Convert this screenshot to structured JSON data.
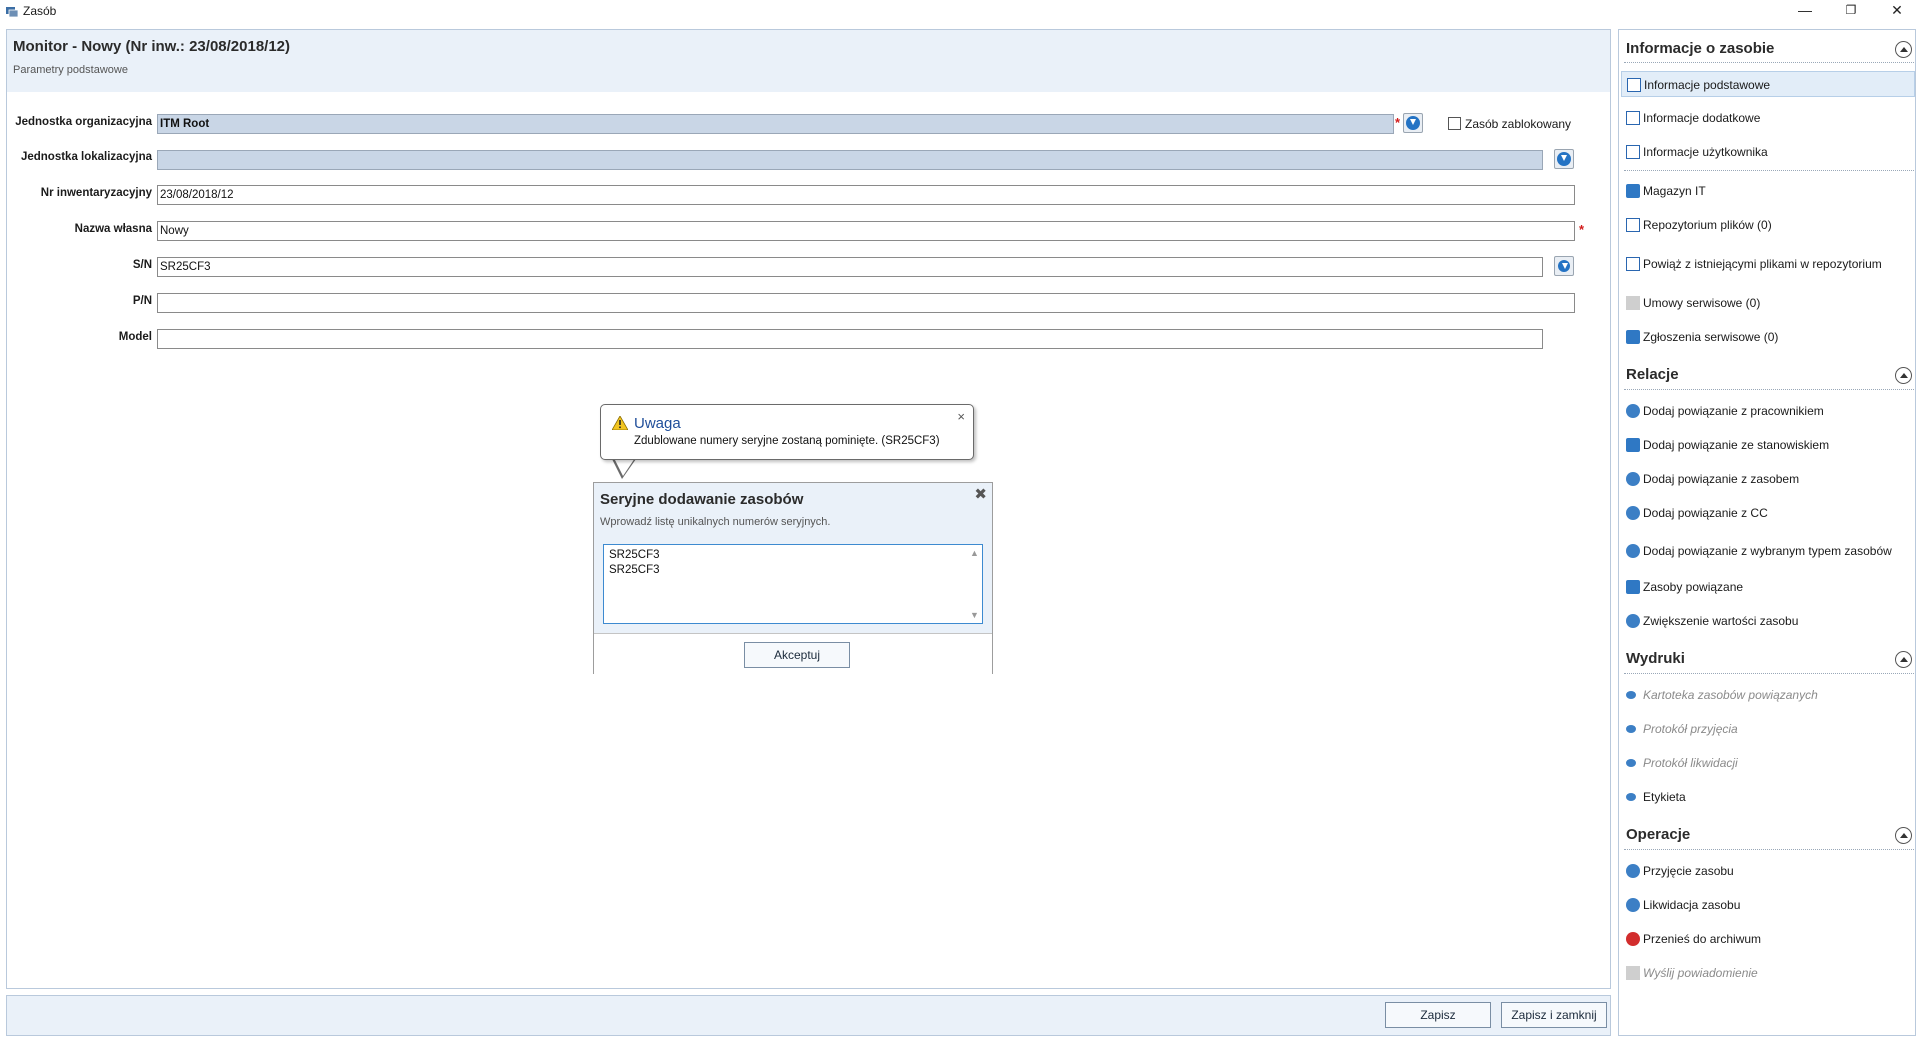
{
  "window": {
    "title": "Zasób",
    "minimize": "—",
    "restore": "❐",
    "close": "✕"
  },
  "header": {
    "title": "Monitor - Nowy (Nr inw.: 23/08/2018/12)",
    "subtitle": "Parametry podstawowe"
  },
  "form": {
    "org_unit_label": "Jednostka organizacyjna",
    "org_unit_value": "ITM Root",
    "loc_unit_label": "Jednostka lokalizacyjna",
    "loc_unit_value": "",
    "inv_label": "Nr inwentaryzacyjny",
    "inv_value": "23/08/2018/12",
    "name_label": "Nazwa własna",
    "name_value": "Nowy",
    "sn_label": "S/N",
    "sn_value": "SR25CF3",
    "pn_label": "P/N",
    "pn_value": "",
    "model_label": "Model",
    "model_value": "",
    "locked_label": "Zasób zablokowany",
    "locked_checked": false,
    "required_mark": "*"
  },
  "balloon": {
    "title": "Uwaga",
    "message": "Zdublowane numery seryjne zostaną pominięte. (SR25CF3)",
    "close": "×"
  },
  "dialog": {
    "title": "Seryjne dodawanie zasobów",
    "subtitle": "Wprowadź listę unikalnych numerów seryjnych.",
    "close": "✖",
    "lines": [
      "SR25CF3",
      "SR25CF3"
    ],
    "accept_label": "Akceptuj"
  },
  "footer": {
    "save_label": "Zapisz",
    "save_close_label": "Zapisz i zamknij"
  },
  "sidebar": {
    "sections": [
      {
        "title": "Informacje o zasobie",
        "items": [
          {
            "label": "Informacje podstawowe",
            "icon": "info-basic-icon"
          },
          {
            "label": "Informacje dodatkowe",
            "icon": "info-extra-icon"
          },
          {
            "label": "Informacje użytkownika",
            "icon": "user-info-icon"
          },
          {
            "label": "Magazyn IT",
            "icon": "warehouse-icon"
          },
          {
            "label": "Repozytorium plików (0)",
            "icon": "file-repo-icon"
          },
          {
            "label": "Powiąż z istniejącymi plikami w repozytorium",
            "icon": "link-files-icon"
          },
          {
            "label": "Umowy serwisowe (0)",
            "icon": "service-contract-icon"
          },
          {
            "label": "Zgłoszenia serwisowe (0)",
            "icon": "service-ticket-icon"
          }
        ]
      },
      {
        "title": "Relacje",
        "items": [
          {
            "label": "Dodaj powiązanie z pracownikiem",
            "icon": "employee-link-icon"
          },
          {
            "label": "Dodaj powiązanie ze stanowiskiem",
            "icon": "workstation-link-icon"
          },
          {
            "label": "Dodaj powiązanie z zasobem",
            "icon": "asset-link-icon"
          },
          {
            "label": "Dodaj powiązanie z CC",
            "icon": "cc-link-icon"
          },
          {
            "label": "Dodaj powiązanie z wybranym typem zasobów",
            "icon": "asset-type-link-icon"
          },
          {
            "label": "Zasoby powiązane",
            "icon": "related-assets-icon"
          },
          {
            "label": "Zwiększenie wartości zasobu",
            "icon": "value-increase-icon"
          }
        ]
      },
      {
        "title": "Wydruki",
        "items": [
          {
            "label": "Kartoteka zasobów powiązanych",
            "icon": "print-icon",
            "disabled": true
          },
          {
            "label": "Protokół przyjęcia",
            "icon": "print-icon",
            "disabled": true
          },
          {
            "label": "Protokół likwidacji",
            "icon": "print-icon",
            "disabled": true
          },
          {
            "label": "Etykieta",
            "icon": "print-icon",
            "disabled": false
          }
        ]
      },
      {
        "title": "Operacje",
        "items": [
          {
            "label": "Przyjęcie zasobu",
            "icon": "accept-asset-icon"
          },
          {
            "label": "Likwidacja zasobu",
            "icon": "liquidate-asset-icon"
          },
          {
            "label": "Przenieś do archiwum",
            "icon": "archive-icon"
          },
          {
            "label": "Wyślij powiadomienie",
            "icon": "notification-icon",
            "disabled": true
          }
        ]
      }
    ]
  },
  "colors": {
    "accent": "#2473c4",
    "header_bg": "#eaf1f9",
    "disabled_field": "#c9d6e6",
    "required": "#d21b1b",
    "danger_icon": "#d22d2d"
  }
}
